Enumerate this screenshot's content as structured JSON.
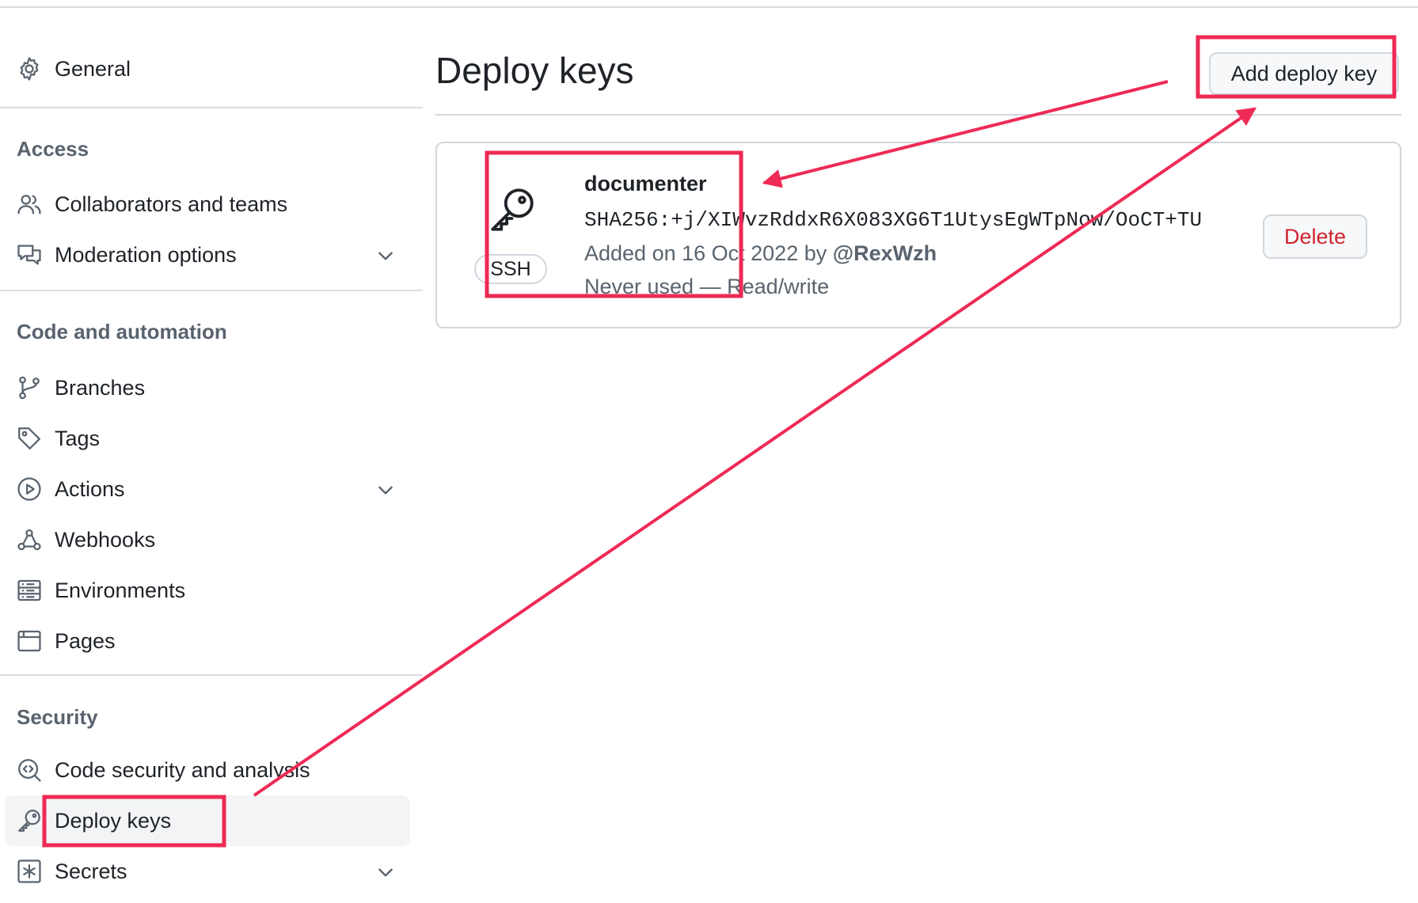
{
  "sidebar": {
    "general": {
      "label": "General",
      "icon": "gear-icon"
    },
    "sections": [
      {
        "heading": "Access",
        "items": [
          {
            "label": "Collaborators and teams",
            "icon": "people-icon"
          },
          {
            "label": "Moderation options",
            "icon": "comment-discussion-icon",
            "expandable": true
          }
        ]
      },
      {
        "heading": "Code and automation",
        "items": [
          {
            "label": "Branches",
            "icon": "git-branch-icon"
          },
          {
            "label": "Tags",
            "icon": "tag-icon"
          },
          {
            "label": "Actions",
            "icon": "play-icon",
            "expandable": true
          },
          {
            "label": "Webhooks",
            "icon": "webhook-icon"
          },
          {
            "label": "Environments",
            "icon": "server-icon"
          },
          {
            "label": "Pages",
            "icon": "browser-icon"
          }
        ]
      },
      {
        "heading": "Security",
        "items": [
          {
            "label": "Code security and analysis",
            "icon": "codescan-icon"
          },
          {
            "label": "Deploy keys",
            "icon": "key-icon",
            "active": true
          },
          {
            "label": "Secrets",
            "icon": "asterisk-icon",
            "expandable": true
          }
        ]
      }
    ]
  },
  "main": {
    "title": "Deploy keys",
    "add_button": "Add deploy key",
    "key": {
      "name": "documenter",
      "fingerprint": "SHA256:+j/XIWvzRddxR6X083XG6T1UtysEgWTpNow/OoCT+TU",
      "added_prefix": "Added on 16 Oct 2022 by",
      "added_by": "@RexWzh",
      "usage": "Never used — Read/write",
      "badge": "SSH",
      "delete_label": "Delete"
    }
  },
  "colors": {
    "annotation": "#ee2a55",
    "delete_text": "#d1242f",
    "active_bg": "#f3f4f6",
    "border": "#d0d7de",
    "muted_text": "#59636e"
  }
}
